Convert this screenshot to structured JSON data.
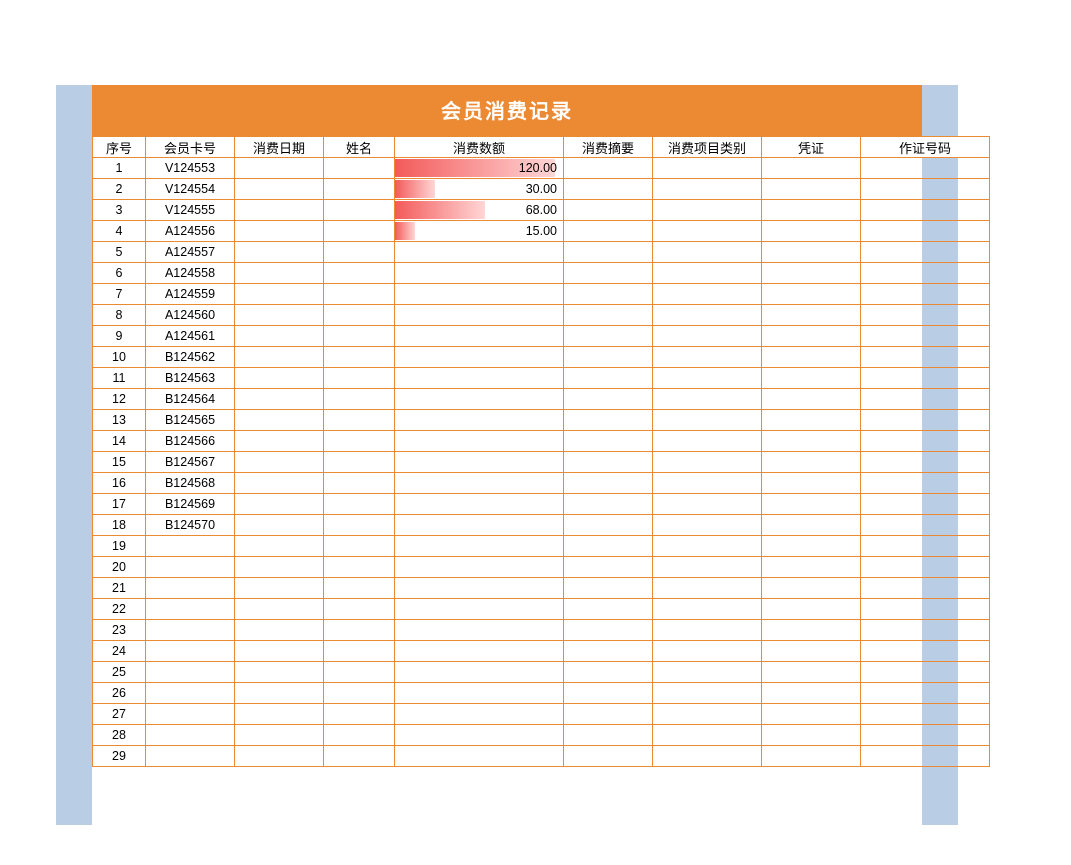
{
  "title": "会员消费记录",
  "columns": [
    "序号",
    "会员卡号",
    "消费日期",
    "姓名",
    "消费数额",
    "消费摘要",
    "消费项目类别",
    "凭证",
    "作证号码"
  ],
  "maxAmount": 120.0,
  "rows": [
    {
      "seq": "1",
      "card": "V124553",
      "date": "",
      "name": "",
      "amount": 120.0,
      "summary": "",
      "category": "",
      "voucher": "",
      "voucherNo": ""
    },
    {
      "seq": "2",
      "card": "V124554",
      "date": "",
      "name": "",
      "amount": 30.0,
      "summary": "",
      "category": "",
      "voucher": "",
      "voucherNo": ""
    },
    {
      "seq": "3",
      "card": "V124555",
      "date": "",
      "name": "",
      "amount": 68.0,
      "summary": "",
      "category": "",
      "voucher": "",
      "voucherNo": ""
    },
    {
      "seq": "4",
      "card": "A124556",
      "date": "",
      "name": "",
      "amount": 15.0,
      "summary": "",
      "category": "",
      "voucher": "",
      "voucherNo": ""
    },
    {
      "seq": "5",
      "card": "A124557",
      "date": "",
      "name": "",
      "amount": null,
      "summary": "",
      "category": "",
      "voucher": "",
      "voucherNo": ""
    },
    {
      "seq": "6",
      "card": "A124558",
      "date": "",
      "name": "",
      "amount": null,
      "summary": "",
      "category": "",
      "voucher": "",
      "voucherNo": ""
    },
    {
      "seq": "7",
      "card": "A124559",
      "date": "",
      "name": "",
      "amount": null,
      "summary": "",
      "category": "",
      "voucher": "",
      "voucherNo": ""
    },
    {
      "seq": "8",
      "card": "A124560",
      "date": "",
      "name": "",
      "amount": null,
      "summary": "",
      "category": "",
      "voucher": "",
      "voucherNo": ""
    },
    {
      "seq": "9",
      "card": "A124561",
      "date": "",
      "name": "",
      "amount": null,
      "summary": "",
      "category": "",
      "voucher": "",
      "voucherNo": ""
    },
    {
      "seq": "10",
      "card": "B124562",
      "date": "",
      "name": "",
      "amount": null,
      "summary": "",
      "category": "",
      "voucher": "",
      "voucherNo": ""
    },
    {
      "seq": "11",
      "card": "B124563",
      "date": "",
      "name": "",
      "amount": null,
      "summary": "",
      "category": "",
      "voucher": "",
      "voucherNo": ""
    },
    {
      "seq": "12",
      "card": "B124564",
      "date": "",
      "name": "",
      "amount": null,
      "summary": "",
      "category": "",
      "voucher": "",
      "voucherNo": ""
    },
    {
      "seq": "13",
      "card": "B124565",
      "date": "",
      "name": "",
      "amount": null,
      "summary": "",
      "category": "",
      "voucher": "",
      "voucherNo": ""
    },
    {
      "seq": "14",
      "card": "B124566",
      "date": "",
      "name": "",
      "amount": null,
      "summary": "",
      "category": "",
      "voucher": "",
      "voucherNo": ""
    },
    {
      "seq": "15",
      "card": "B124567",
      "date": "",
      "name": "",
      "amount": null,
      "summary": "",
      "category": "",
      "voucher": "",
      "voucherNo": ""
    },
    {
      "seq": "16",
      "card": "B124568",
      "date": "",
      "name": "",
      "amount": null,
      "summary": "",
      "category": "",
      "voucher": "",
      "voucherNo": ""
    },
    {
      "seq": "17",
      "card": "B124569",
      "date": "",
      "name": "",
      "amount": null,
      "summary": "",
      "category": "",
      "voucher": "",
      "voucherNo": ""
    },
    {
      "seq": "18",
      "card": "B124570",
      "date": "",
      "name": "",
      "amount": null,
      "summary": "",
      "category": "",
      "voucher": "",
      "voucherNo": ""
    },
    {
      "seq": "19",
      "card": "",
      "date": "",
      "name": "",
      "amount": null,
      "summary": "",
      "category": "",
      "voucher": "",
      "voucherNo": ""
    },
    {
      "seq": "20",
      "card": "",
      "date": "",
      "name": "",
      "amount": null,
      "summary": "",
      "category": "",
      "voucher": "",
      "voucherNo": ""
    },
    {
      "seq": "21",
      "card": "",
      "date": "",
      "name": "",
      "amount": null,
      "summary": "",
      "category": "",
      "voucher": "",
      "voucherNo": ""
    },
    {
      "seq": "22",
      "card": "",
      "date": "",
      "name": "",
      "amount": null,
      "summary": "",
      "category": "",
      "voucher": "",
      "voucherNo": ""
    },
    {
      "seq": "23",
      "card": "",
      "date": "",
      "name": "",
      "amount": null,
      "summary": "",
      "category": "",
      "voucher": "",
      "voucherNo": ""
    },
    {
      "seq": "24",
      "card": "",
      "date": "",
      "name": "",
      "amount": null,
      "summary": "",
      "category": "",
      "voucher": "",
      "voucherNo": ""
    },
    {
      "seq": "25",
      "card": "",
      "date": "",
      "name": "",
      "amount": null,
      "summary": "",
      "category": "",
      "voucher": "",
      "voucherNo": ""
    },
    {
      "seq": "26",
      "card": "",
      "date": "",
      "name": "",
      "amount": null,
      "summary": "",
      "category": "",
      "voucher": "",
      "voucherNo": ""
    },
    {
      "seq": "27",
      "card": "",
      "date": "",
      "name": "",
      "amount": null,
      "summary": "",
      "category": "",
      "voucher": "",
      "voucherNo": ""
    },
    {
      "seq": "28",
      "card": "",
      "date": "",
      "name": "",
      "amount": null,
      "summary": "",
      "category": "",
      "voucher": "",
      "voucherNo": ""
    },
    {
      "seq": "29",
      "card": "",
      "date": "",
      "name": "",
      "amount": null,
      "summary": "",
      "category": "",
      "voucher": "",
      "voucherNo": ""
    }
  ],
  "chart_data": {
    "type": "bar",
    "title": "会员消费记录 — 消费数额 data bars",
    "categories": [
      "V124553",
      "V124554",
      "V124555",
      "A124556"
    ],
    "values": [
      120.0,
      30.0,
      68.0,
      15.0
    ],
    "xlabel": "会员卡号",
    "ylabel": "消费数额",
    "ylim": [
      0,
      120
    ]
  }
}
